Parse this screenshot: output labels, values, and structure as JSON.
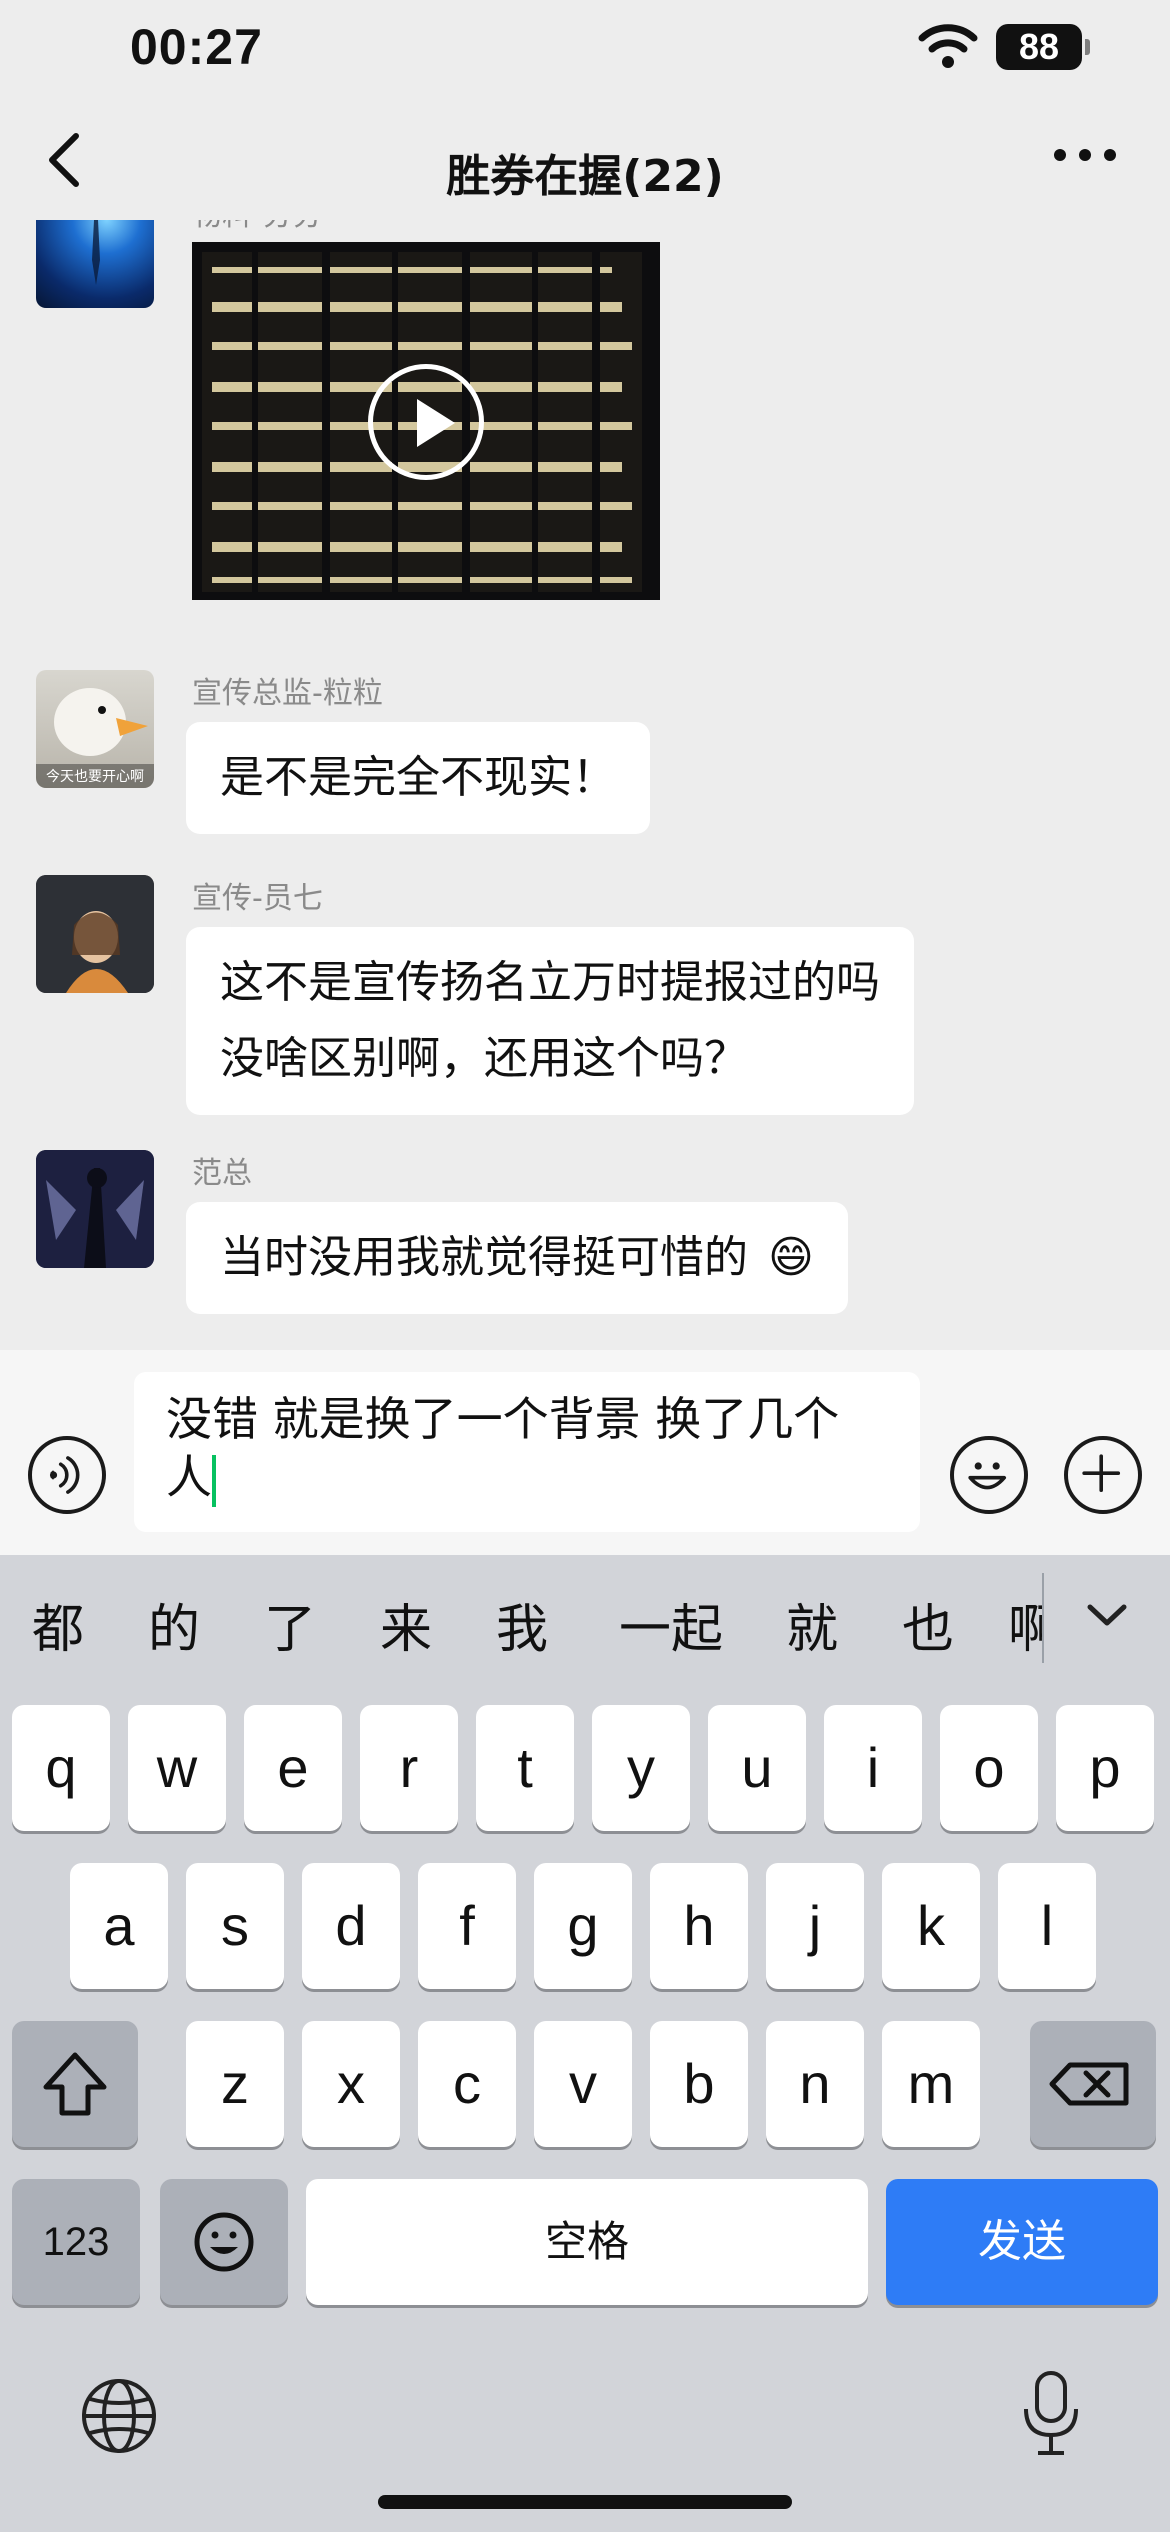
{
  "status_bar": {
    "time": "00:27",
    "battery": "88"
  },
  "header": {
    "title": "胜券在握(22)"
  },
  "messages": [
    {
      "sender": "物料-分分",
      "type": "video"
    },
    {
      "sender": "宣传总监-粒粒",
      "lines": [
        "是不是完全不现实！"
      ],
      "avatar_caption": "今天也要开心啊"
    },
    {
      "sender": "宣传-员七",
      "lines": [
        "这不是宣传扬名立万时提报过的吗",
        "没啥区别啊，还用这个吗？"
      ]
    },
    {
      "sender": "范总",
      "lines": [
        "当时没用我就觉得挺可惜的"
      ],
      "emoji": "😄"
    }
  ],
  "input": {
    "line1": "没错 就是换了一个背景 换了几个",
    "line2": "人"
  },
  "keyboard": {
    "candidates": [
      "都",
      "的",
      "了",
      "来",
      "我",
      "一起",
      "就",
      "也",
      "啊"
    ],
    "row1": [
      "q",
      "w",
      "e",
      "r",
      "t",
      "y",
      "u",
      "i",
      "o",
      "p"
    ],
    "row2": [
      "a",
      "s",
      "d",
      "f",
      "g",
      "h",
      "j",
      "k",
      "l"
    ],
    "row3": [
      "z",
      "x",
      "c",
      "v",
      "b",
      "n",
      "m"
    ],
    "num_label": "123",
    "space_label": "空格",
    "send_label": "发送"
  },
  "colors": {
    "send": "#2e7cf6",
    "caret": "#07c160",
    "keyboard_bg": "#d2d4d9",
    "chat_bg": "#ededed"
  }
}
